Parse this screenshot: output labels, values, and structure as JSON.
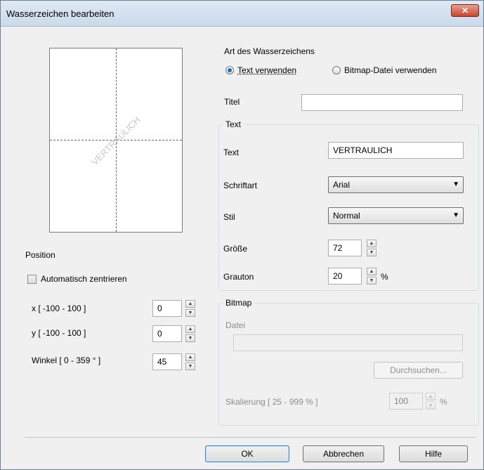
{
  "window": {
    "title": "Wasserzeichen bearbeiten",
    "close_glyph": "✕"
  },
  "preview": {
    "watermark_text": "VERTRAULICH"
  },
  "type": {
    "heading": "Art des Wasserzeichens",
    "use_text": "Text verwenden",
    "use_bitmap": "Bitmap-Datei verwenden",
    "selected": "text"
  },
  "title_field": {
    "label": "Titel",
    "value": ""
  },
  "text_group": {
    "legend": "Text",
    "text_label": "Text",
    "text_value": "VERTRAULICH",
    "font_label": "Schriftart",
    "font_value": "Arial",
    "style_label": "Stil",
    "style_value": "Normal",
    "size_label": "Größe",
    "size_value": "72",
    "gray_label": "Grauton",
    "gray_value": "20",
    "gray_unit": "%"
  },
  "bitmap_group": {
    "legend": "Bitmap",
    "file_label": "Datei",
    "file_value": "",
    "browse_label": "Durchsuchen...",
    "scale_label": "Skalierung [ 25 - 999 % ]",
    "scale_value": "100",
    "scale_unit": "%"
  },
  "position": {
    "heading": "Position",
    "auto_center_label": "Automatisch zentrieren",
    "auto_center_checked": false,
    "x_label": "x [ -100  -  100 ]",
    "x_value": "0",
    "y_label": "y [ -100  -  100 ]",
    "y_value": "0",
    "angle_label": "Winkel [ 0 - 359 ° ]",
    "angle_value": "45"
  },
  "buttons": {
    "ok": "OK",
    "cancel": "Abbrechen",
    "help": "Hilfe"
  },
  "icons": {
    "up": "▲",
    "down": "▼",
    "dropdown": "▼"
  }
}
